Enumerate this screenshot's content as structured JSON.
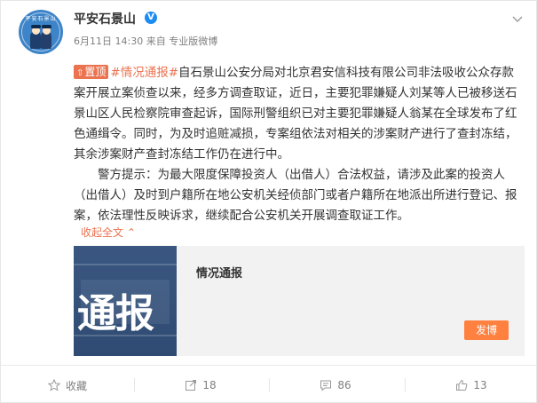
{
  "user": {
    "name": "平安石景山",
    "verified_mark": "V",
    "avatar_text": "平安石景山"
  },
  "meta": {
    "time": "6月11日 14:30",
    "source": "来自 专业版微博"
  },
  "post": {
    "pin_label": "置顶",
    "tag": "#情况通报#",
    "paragraph1": "自石景山公安分局对北京君安信科技有限公司非法吸收公众存款案开展立案侦查以来，经多方调查取证，近日，主要犯罪嫌疑人刘某等人已被移送石景山区人民检察院审查起诉，国际刑警组织已对主要犯罪嫌疑人翁某在全球发布了红色通缉令。同时，为及时追赃减损，专案组依法对相关的涉案财产进行了查封冻结，其余涉案财产查封冻结工作仍在进行中。",
    "paragraph2": "警方提示：为最大限度保障投资人（出借人）合法权益，请涉及此案的投资人（出借人）及时到户籍所在地公安机关经侦部门或者户籍所在地派出所进行登记、报案，依法理性反映诉求，继续配合公安机关开展调查取证工作。",
    "collapse_label": "收起全文"
  },
  "share_card": {
    "thumb_text": "通报",
    "title": "情况通报",
    "button_label": "发博"
  },
  "actions": {
    "favorite_label": "收藏",
    "repost_count": "18",
    "comment_count": "86",
    "like_count": "13"
  },
  "colors": {
    "accent": "#eb7350",
    "verified": "#1d8cf2",
    "button": "#ff8140"
  }
}
